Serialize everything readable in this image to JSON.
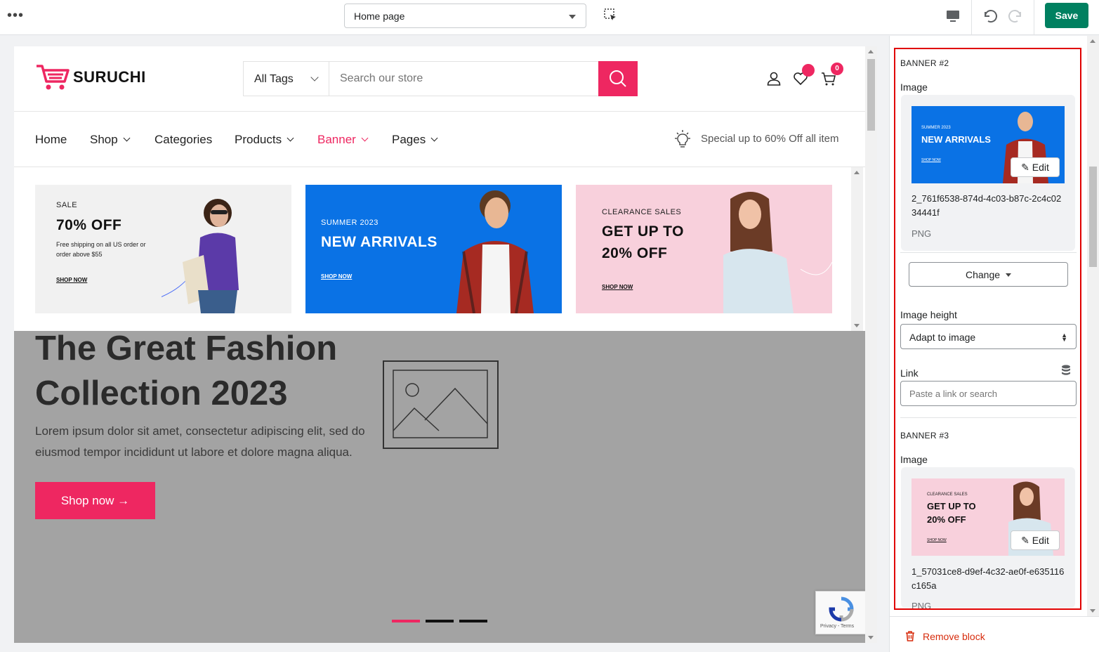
{
  "topbar": {
    "page_select": "Home page",
    "save_label": "Save"
  },
  "site": {
    "logo_text": "SURUCHI",
    "tags_label": "All Tags",
    "search_placeholder": "Search our store",
    "wishlist_badge": "",
    "cart_badge": "0",
    "nav": [
      "Home",
      "Shop",
      "Categories",
      "Products",
      "Banner",
      "Pages"
    ],
    "promo_text": "Special up to 60% Off all item"
  },
  "banners": [
    {
      "small": "SALE",
      "big": "70% OFF",
      "desc": "Free shipping on all US order or order above $55",
      "link": "SHOP NOW"
    },
    {
      "small": "SUMMER 2023",
      "big": "NEW ARRIVALS",
      "link": "SHOP NOW"
    },
    {
      "small": "CLEARANCE SALES",
      "big1": "GET UP TO",
      "big2": "20% OFF",
      "link": "SHOP NOW"
    }
  ],
  "hero": {
    "title_line1": "The Great Fashion",
    "title_line2": "Collection 2023",
    "text": "Lorem ipsum dolor sit amet, consectetur adipiscing elit, sed do eiusmod tempor incididunt ut labore et dolore magna aliqua.",
    "button": "Shop now"
  },
  "recaptcha_text": "Privacy - Terms",
  "panel": {
    "banner2": {
      "title": "BANNER #2",
      "image_label": "Image",
      "thumb_small": "SUMMER 2023",
      "thumb_big": "NEW ARRIVALS",
      "thumb_link": "SHOP NOW",
      "edit_label": "Edit",
      "filename": "2_761f6538-874d-4c03-b87c-2c4c0234441f",
      "filetype": "PNG",
      "change_label": "Change",
      "height_label": "Image height",
      "height_value": "Adapt to image",
      "link_label": "Link",
      "link_placeholder": "Paste a link or search"
    },
    "banner3": {
      "title": "BANNER #3",
      "image_label": "Image",
      "thumb_small": "CLEARANCE SALES",
      "thumb_big1": "GET UP TO",
      "thumb_big2": "20% OFF",
      "thumb_link": "SHOP NOW",
      "edit_label": "Edit",
      "filename": "1_57031ce8-d9ef-4c32-ae0f-e635116c165a",
      "filetype": "PNG"
    },
    "remove_label": "Remove block"
  },
  "colors": {
    "brand_pink": "#ee2761",
    "save_green": "#008060",
    "highlight_red": "#e00000",
    "banner_blue": "#0a72e5"
  }
}
